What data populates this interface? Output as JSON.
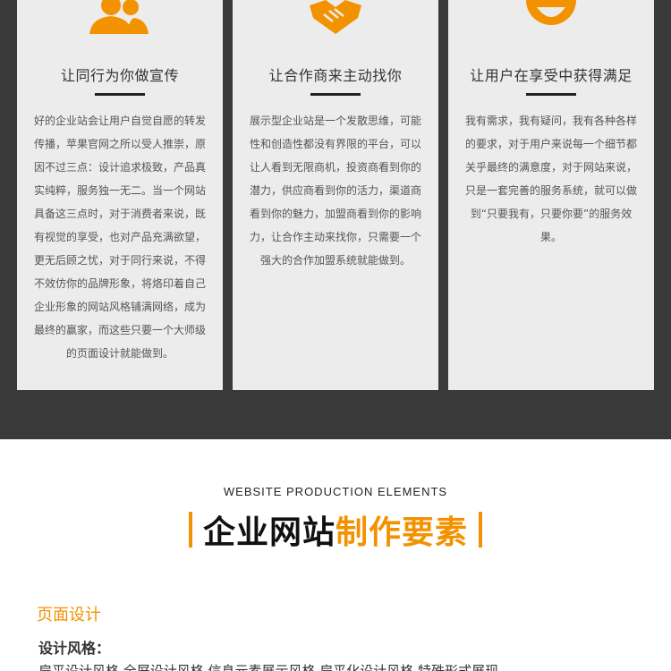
{
  "colors": {
    "accent": "#f39200",
    "dark_band": "#3a3939",
    "card_bg": "#ececec"
  },
  "cards": [
    {
      "icon": "users-icon",
      "title": "让同行为你做宣传",
      "lines": [
        "好的企业站会让用户自觉自愿的转发",
        "传播，苹果官网之所以受人推崇，原",
        "因不过三点：设计追求极致，产品真",
        "实纯粹，服务独一无二。当一个网站",
        "具备这三点时，对于消费者来说，既",
        "有视觉的享受，也对产品充满欲望，",
        "更无后顾之忧，对于同行来说，不得",
        "不效仿你的品牌形象，将烙印着自己",
        "企业形象的网站风格铺满网络，成为",
        "最终的赢家，而这些只要一个大师级",
        "的页面设计就能做到。"
      ]
    },
    {
      "icon": "handshake-icon",
      "title": "让合作商来主动找你",
      "lines": [
        "展示型企业站是一个发散思维，可能",
        "性和创造性都没有界限的平台，可以",
        "让人看到无限商机，投资商看到你的",
        "潜力，供应商看到你的活力，渠道商",
        "看到你的魅力，加盟商看到你的影响",
        "力，让合作主动来找你，只需要一个",
        "强大的合作加盟系统就能做到。"
      ]
    },
    {
      "icon": "smile-icon",
      "title": "让用户在享受中获得满足",
      "lines": [
        "我有需求，我有疑问，我有各种各样",
        "的要求，对于用户来说每一个细节都",
        "关乎最终的满意度，对于网站来说，",
        "只是一套完善的服务系统，就可以做",
        "到“只要我有，只要你要”的服务效",
        "果。"
      ]
    }
  ],
  "section": {
    "subtitle": "WEBSITE PRODUCTION ELEMENTS",
    "title_dark": "企业网站",
    "title_orange": "制作要素"
  },
  "page_design": {
    "heading": "页面设计",
    "style_label": "设计风格：",
    "styles_line": "扁平设计风格  全屏设计风格  信息元素展示风格  扁平化设计风格  特殊形式展现"
  }
}
